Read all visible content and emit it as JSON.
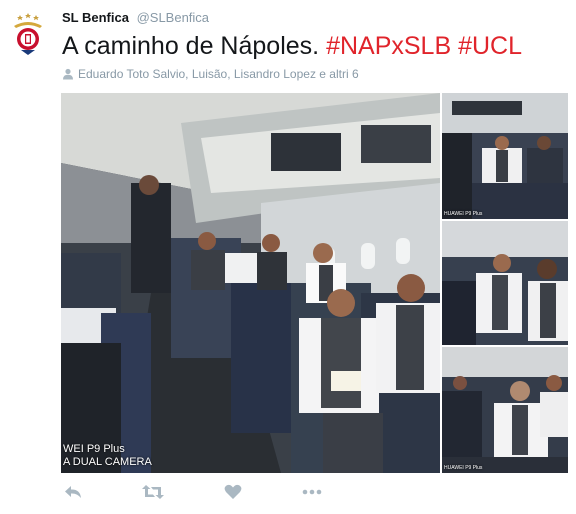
{
  "tweet": {
    "author_name": "SL Benfica",
    "author_handle": "@SLBenfica",
    "text_plain": "A caminho de Nápoles. ",
    "hashtags": [
      "#NAPxSLB",
      "#UCL"
    ],
    "tagged_people": "Eduardo Toto Salvio, Luisão, Lisandro Lopez e altri 6",
    "photo_watermark_line1": "WEI P9 Plus",
    "photo_watermark_line2": "A DUAL CAMERA",
    "thumb_watermark": "HUAWEI P9 Plus",
    "accent_color": "#e0242b"
  },
  "icons": {
    "tagged": "person-icon",
    "reply": "reply-icon",
    "retweet": "retweet-icon",
    "like": "heart-icon",
    "more": "more-icon",
    "avatar": "benfica-crest-icon"
  }
}
